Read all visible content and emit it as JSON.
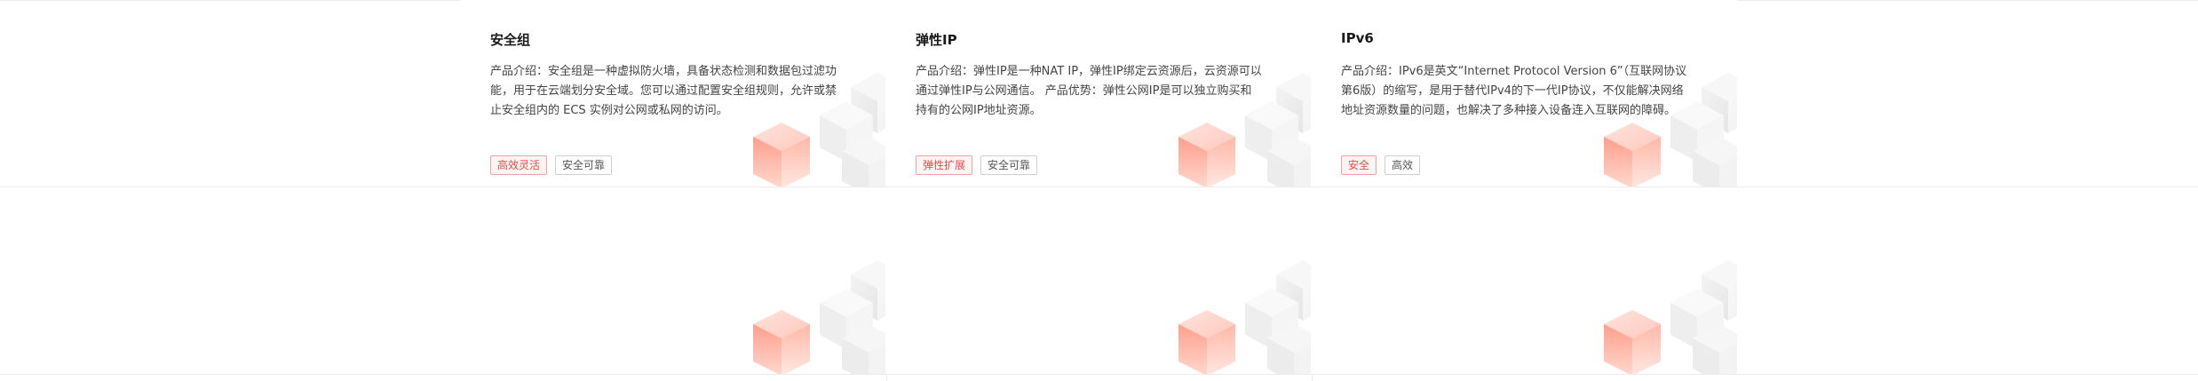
{
  "cards": [
    {
      "title": "安全组",
      "desc": "产品介绍：安全组是一种虚拟防火墙，具备状态检测和数据包过滤功能，用于在云端划分安全域。您可以通过配置安全组规则，允许或禁止安全组内的 ECS 实例对公网或私网的访问。",
      "tags": [
        "高效灵活",
        "安全可靠"
      ]
    },
    {
      "title": "弹性IP",
      "desc": "产品介绍：弹性IP是一种NAT IP，弹性IP绑定云资源后，云资源可以通过弹性IP与公网通信。 产品优势：弹性公网IP是可以独立购买和持有的公网IP地址资源。",
      "tags": [
        "弹性扩展",
        "安全可靠"
      ]
    },
    {
      "title": "IPv6",
      "desc": "产品介绍：IPv6是英文“Internet Protocol Version 6”（互联网协议第6版）的缩写，是用于替代IPv4的下一代IP协议，不仅能解决网络地址资源数量的问题，也解决了多种接入设备连入互联网的障碍。",
      "tags": [
        "安全",
        "高效"
      ]
    }
  ],
  "colors": {
    "accent_red": "#e84a4a",
    "tag_red_border": "#f6a2a2",
    "divider": "#ececec"
  },
  "icons": [
    "cube-decoration-icon"
  ]
}
